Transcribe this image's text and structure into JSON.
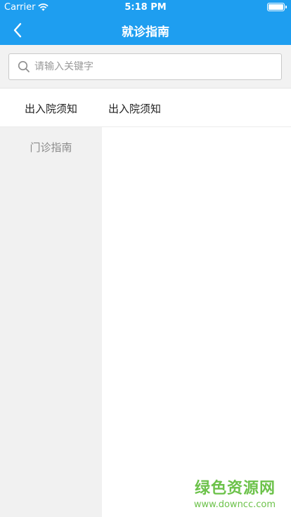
{
  "status_bar": {
    "carrier": "Carrier",
    "time": "5:18 PM"
  },
  "navbar": {
    "title": "就诊指南",
    "back_icon": "chevron-left-icon"
  },
  "search": {
    "placeholder": "请输入关键字",
    "value": ""
  },
  "header": {
    "left_label": "出入院须知",
    "right_label": "出入院须知"
  },
  "sidebar": {
    "items": [
      {
        "label": "门诊指南"
      }
    ]
  },
  "watermark": {
    "main": "绿色资源网",
    "sub": "www.downcc.com"
  },
  "colors": {
    "accent": "#1e9ef0",
    "sidebar_bg": "#f1f1f1",
    "watermark": "#6cc24a"
  }
}
